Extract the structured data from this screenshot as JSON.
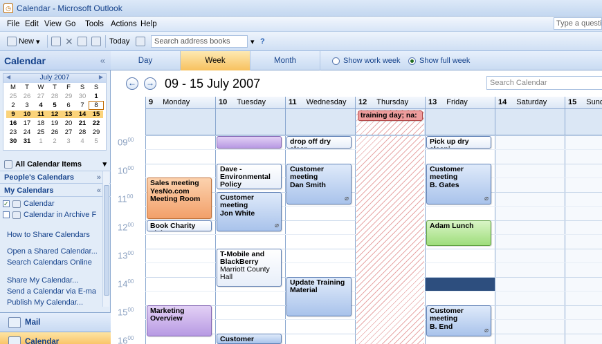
{
  "window": {
    "title": "Calendar - Microsoft Outlook",
    "help_placeholder": "Type a question"
  },
  "menu": [
    "File",
    "Edit",
    "View",
    "Go",
    "Tools",
    "Actions",
    "Help"
  ],
  "toolbar": {
    "new_label": "New",
    "today_label": "Today",
    "search_placeholder": "Search address books"
  },
  "nav": {
    "title": "Calendar",
    "minical": {
      "month": "July 2007",
      "dow": [
        "M",
        "T",
        "W",
        "T",
        "F",
        "S",
        "S"
      ],
      "weeks": [
        [
          "25",
          "26",
          "27",
          "28",
          "29",
          "30",
          "1"
        ],
        [
          "2",
          "3",
          "4",
          "5",
          "6",
          "7",
          "8"
        ],
        [
          "9",
          "10",
          "11",
          "12",
          "13",
          "14",
          "15"
        ],
        [
          "16",
          "17",
          "18",
          "19",
          "20",
          "21",
          "22"
        ],
        [
          "23",
          "24",
          "25",
          "26",
          "27",
          "28",
          "29"
        ],
        [
          "30",
          "31",
          "1",
          "2",
          "3",
          "4",
          "5"
        ]
      ]
    },
    "all_items": "All Calendar Items",
    "peoples_calendars": "People's Calendars",
    "my_calendars": "My Calendars",
    "calendars": [
      "Calendar",
      "Calendar in Archive F"
    ],
    "links": [
      "How to Share Calendars",
      "Open a Shared Calendar...",
      "Search Calendars Online",
      "Share My Calendar...",
      "Send a Calendar via E-ma",
      "Publish My Calendar..."
    ],
    "buttons": {
      "mail": "Mail",
      "calendar": "Calendar"
    }
  },
  "view": {
    "tabs": [
      "Day",
      "Week",
      "Month"
    ],
    "show_work_week": "Show work week",
    "show_full_week": "Show full week",
    "date_range": "09 - 15 July 2007",
    "search_placeholder": "Search Calendar"
  },
  "days": [
    {
      "num": "9",
      "name": "Monday"
    },
    {
      "num": "10",
      "name": "Tuesday"
    },
    {
      "num": "11",
      "name": "Wednesday"
    },
    {
      "num": "12",
      "name": "Thursday"
    },
    {
      "num": "13",
      "name": "Friday"
    },
    {
      "num": "14",
      "name": "Saturday"
    },
    {
      "num": "15",
      "name": "Sunday"
    }
  ],
  "hours": [
    "09",
    "10",
    "11",
    "12",
    "13",
    "14",
    "15",
    "16"
  ],
  "minutes_label": "00",
  "allday_event": "training day; na:",
  "appointments": {
    "drop_off": "drop off dry clear",
    "pick_up": "Pick up dry cleani",
    "dave": "Dave - Environmental Policy",
    "cust_wed_title": "Customer meeting",
    "cust_wed_who": "Dan Smith",
    "cust_fri_title": "Customer meeting",
    "cust_fri_who": "B. Gates",
    "sales_title": "Sales meeting",
    "sales_loc": "YesNo.com Meeting Room",
    "cust_tue_title": "Customer meeting",
    "cust_tue_who": "Jon White",
    "book_charity": "Book Charity Tick",
    "adam_lunch": "Adam Lunch",
    "tmobile_title": "T-Mobile and BlackBerry",
    "tmobile_loc": "Marriott County Hall",
    "update_training": "Update Training Material",
    "marketing": "Marketing Overview",
    "cust_fri2_title": "Customer meeting",
    "cust_fri2_who": "B. End",
    "cust_tue2_title": "Customer"
  }
}
